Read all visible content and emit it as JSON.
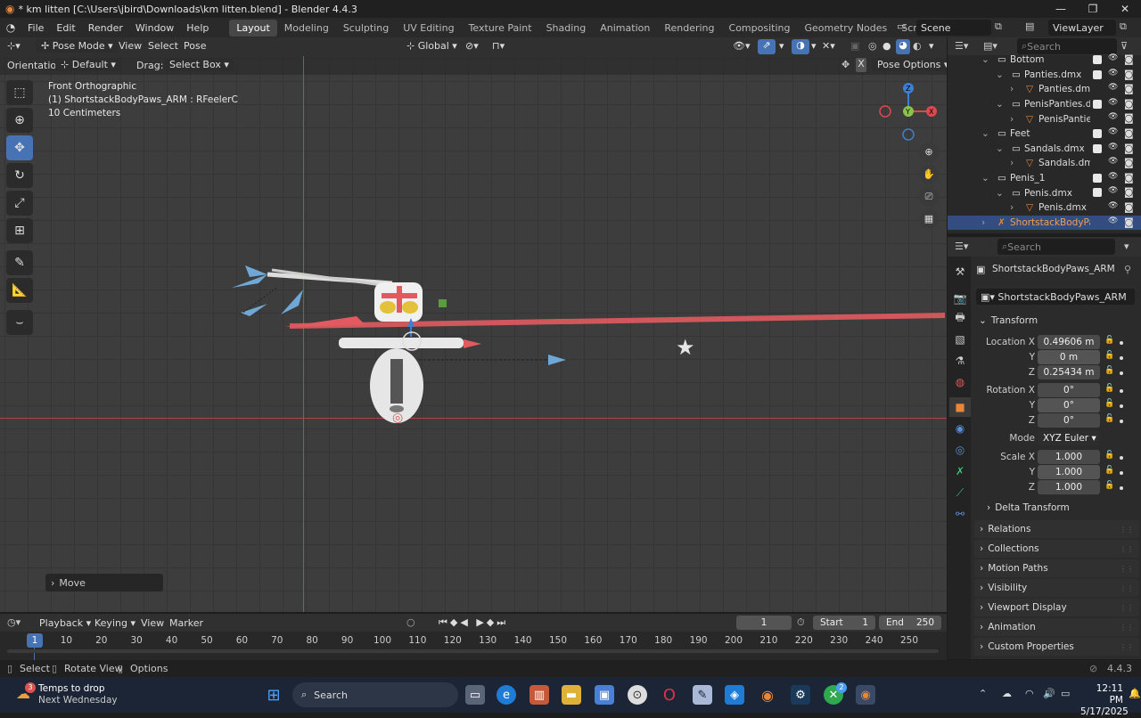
{
  "window": {
    "title": "* km litten [C:\\Users\\jbird\\Downloads\\km litten.blend] - Blender 4.4.3",
    "minimize": "—",
    "maximize": "❐",
    "close": "✕"
  },
  "menu": [
    "File",
    "Edit",
    "Render",
    "Window",
    "Help"
  ],
  "workspaces": [
    "Layout",
    "Modeling",
    "Sculpting",
    "UV Editing",
    "Texture Paint",
    "Shading",
    "Animation",
    "Rendering",
    "Compositing",
    "Geometry Nodes",
    "Scripting"
  ],
  "scene": "Scene",
  "view_layer": "ViewLayer",
  "viewport_header": {
    "mode": "Pose Mode",
    "view": "View",
    "select": "Select",
    "pose": "Pose",
    "transform_orientation": "Global"
  },
  "tool_settings": {
    "orientation_label": "Orientation:",
    "orientation": "Default",
    "drag_label": "Drag:",
    "drag": "Select Box",
    "pose_options": "Pose Options"
  },
  "viewport_overlay": {
    "view_name": "Front Orthographic",
    "object": "(1) ShortstackBodyPaws_ARM : RFeelerC",
    "scale": "10 Centimeters"
  },
  "operator_panel": "Move",
  "outliner": {
    "search_placeholder": "Search",
    "rows": [
      {
        "label": "Bottom",
        "indent": 0,
        "type": "collection"
      },
      {
        "label": "Panties.dmx",
        "indent": 1,
        "type": "collection"
      },
      {
        "label": "Panties.dmx",
        "indent": 2,
        "type": "mesh"
      },
      {
        "label": "PenisPanties.dm",
        "indent": 1,
        "type": "collection"
      },
      {
        "label": "PenisPanties",
        "indent": 2,
        "type": "mesh"
      },
      {
        "label": "Feet",
        "indent": 0,
        "type": "collection"
      },
      {
        "label": "Sandals.dmx",
        "indent": 1,
        "type": "collection"
      },
      {
        "label": "Sandals.dmx",
        "indent": 2,
        "type": "mesh"
      },
      {
        "label": "Penis_1",
        "indent": 0,
        "type": "collection"
      },
      {
        "label": "Penis.dmx",
        "indent": 1,
        "type": "collection"
      },
      {
        "label": "Penis.dmx",
        "indent": 2,
        "type": "mesh"
      },
      {
        "label": "ShortstackBodyPaw",
        "indent": 0,
        "type": "armature",
        "selected": true
      }
    ]
  },
  "properties": {
    "search_placeholder": "Search",
    "object_name": "ShortstackBodyPaws_ARM",
    "data_name": "ShortstackBodyPaws_ARM",
    "transform_label": "Transform",
    "location_label": "Location X",
    "location": [
      "0.49606 m",
      "0 m",
      "0.25434 m"
    ],
    "rotation_label": "Rotation X",
    "rotation": [
      "0°",
      "0°",
      "0°"
    ],
    "axis_y": "Y",
    "axis_z": "Z",
    "mode_label": "Mode",
    "mode": "XYZ Euler",
    "scale_label": "Scale X",
    "scale": [
      "1.000",
      "1.000",
      "1.000"
    ],
    "delta": "Delta Transform",
    "panels": [
      "Relations",
      "Collections",
      "Motion Paths",
      "Visibility",
      "Viewport Display",
      "Animation",
      "Custom Properties"
    ]
  },
  "timeline": {
    "menus": [
      "Playback",
      "Keying",
      "View",
      "Marker"
    ],
    "current_frame": "1",
    "start_label": "Start",
    "start": "1",
    "end_label": "End",
    "end": "250",
    "frames": [
      "1",
      "10",
      "20",
      "30",
      "40",
      "50",
      "60",
      "70",
      "80",
      "90",
      "100",
      "110",
      "120",
      "130",
      "140",
      "150",
      "160",
      "170",
      "180",
      "190",
      "200",
      "210",
      "220",
      "230",
      "240",
      "250"
    ]
  },
  "statusbar": {
    "select": "Select",
    "rotate": "Rotate View",
    "options": "Options",
    "version": "4.4.3"
  },
  "taskbar": {
    "weather_title": "Temps to drop",
    "weather_sub": "Next Wednesday",
    "weather_badge": "3",
    "search": "Search",
    "time": "12:11 PM",
    "date": "5/17/2025",
    "xbox_badge": "2"
  },
  "colors": {
    "accent": "#4772b3",
    "selected_row": "#334d80",
    "x_axis": "#e0484e",
    "y_axis": "#8bc34a",
    "z_axis": "#3d7fd6",
    "armature": "#e8873a"
  }
}
